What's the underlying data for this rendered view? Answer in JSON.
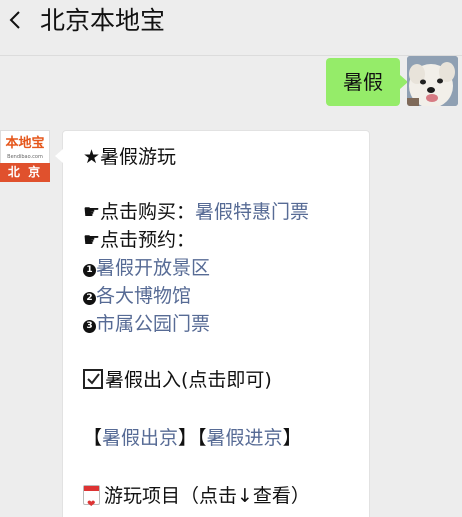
{
  "header": {
    "title": "北京本地宝",
    "back_icon": "chevron-left-icon"
  },
  "outgoing": {
    "text": "暑假"
  },
  "bot": {
    "avatar_logo": "本地宝",
    "avatar_sub": "Bendibao.com",
    "avatar_city": "北 京"
  },
  "message": {
    "title": "★暑假游玩",
    "buy_prefix": "☛点击购买：",
    "buy_link": "暑假特惠门票",
    "reserve_label": "☛点击预约：",
    "items": [
      {
        "num": "1",
        "label": "暑假开放景区"
      },
      {
        "num": "2",
        "label": "各大博物馆"
      },
      {
        "num": "3",
        "label": "市属公园门票"
      }
    ],
    "travel_label": "暑假出入(点击即可)",
    "bracket_open1": "【",
    "link_out": "暑假出京",
    "bracket_mid": "】【",
    "link_in": "暑假进京",
    "bracket_close2": "】",
    "projects_label": "游玩项目（点击↓查看）"
  },
  "colors": {
    "link": "#576b95",
    "outgoing_bubble": "#95ec69",
    "background": "#ededed"
  }
}
